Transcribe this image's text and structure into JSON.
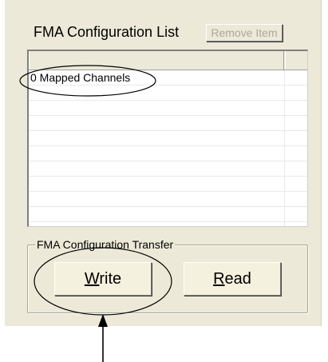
{
  "list": {
    "title": "FMA Configuration List",
    "remove_button": "Remove Item",
    "rows": [
      "0 Mapped Channels",
      "",
      "",
      "",
      "",
      "",
      "",
      "",
      "",
      ""
    ]
  },
  "transfer": {
    "group_label": "FMA Configuration Transfer",
    "write_button": {
      "access_key": "W",
      "rest": "rite"
    },
    "read_button": {
      "access_key": "R",
      "rest": "ead"
    }
  },
  "colors": {
    "panel": "#ece9d8",
    "disabled_text": "#aca899"
  }
}
